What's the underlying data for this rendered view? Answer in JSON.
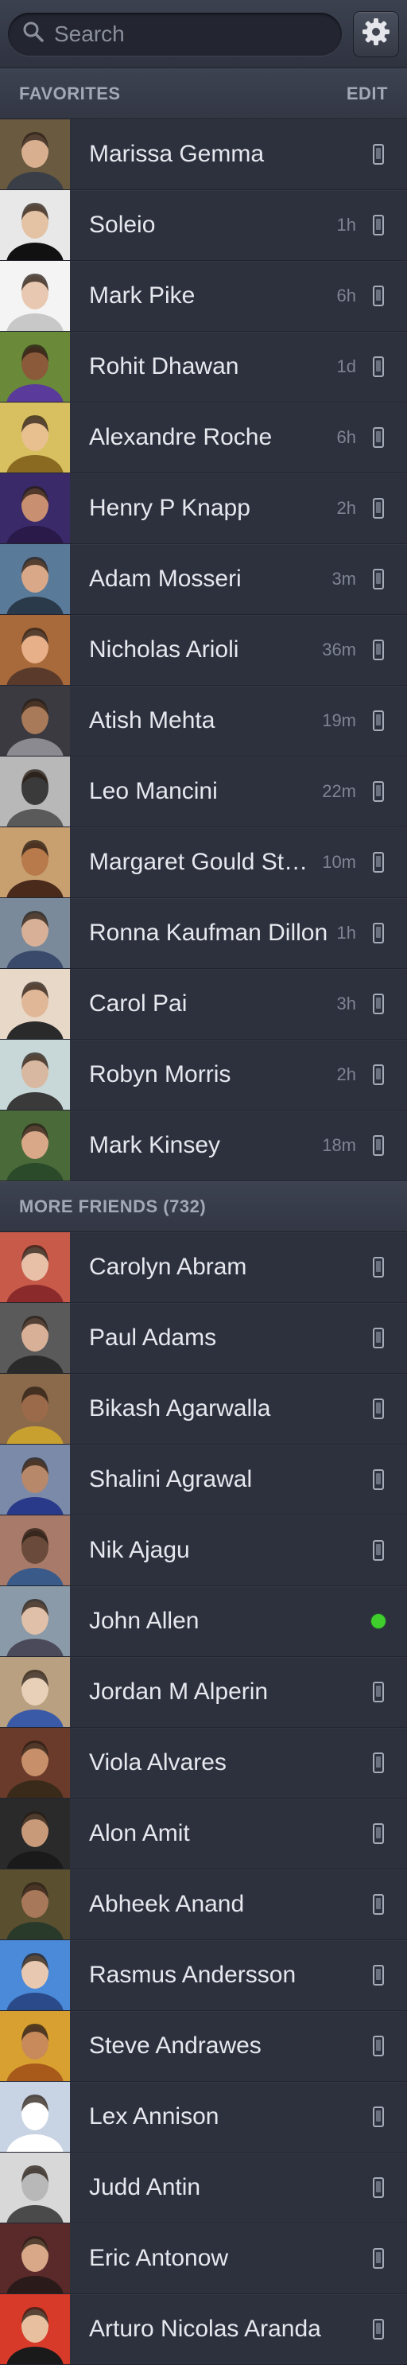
{
  "search": {
    "placeholder": "Search",
    "icon": "search-icon"
  },
  "settings": {
    "icon": "gear-icon"
  },
  "favorites": {
    "title": "FAVORITES",
    "edit_label": "EDIT",
    "items": [
      {
        "name": "Marissa Gemma",
        "time": "",
        "status": "mobile",
        "avatar_bg": "#6a5a40",
        "skin": "#d8b090",
        "shirt": "#3a3f47"
      },
      {
        "name": "Soleio",
        "time": "1h",
        "status": "mobile",
        "avatar_bg": "#e8e8e8",
        "skin": "#e4c2a4",
        "shirt": "#111111"
      },
      {
        "name": "Mark Pike",
        "time": "6h",
        "status": "mobile",
        "avatar_bg": "#f4f4f4",
        "skin": "#e8c8b0",
        "shirt": "#c8c8c8"
      },
      {
        "name": "Rohit Dhawan",
        "time": "1d",
        "status": "mobile",
        "avatar_bg": "#6a8a3a",
        "skin": "#8a5a3a",
        "shirt": "#5a3a9a"
      },
      {
        "name": "Alexandre Roche",
        "time": "6h",
        "status": "mobile",
        "avatar_bg": "#d8c060",
        "skin": "#e8c090",
        "shirt": "#8a6a20"
      },
      {
        "name": "Henry P Knapp",
        "time": "2h",
        "status": "mobile",
        "avatar_bg": "#3a2a6a",
        "skin": "#c89070",
        "shirt": "#2a1a4a"
      },
      {
        "name": "Adam Mosseri",
        "time": "3m",
        "status": "mobile",
        "avatar_bg": "#5a7a9a",
        "skin": "#d8a888",
        "shirt": "#2a3a4a"
      },
      {
        "name": "Nicholas Arioli",
        "time": "36m",
        "status": "mobile",
        "avatar_bg": "#a86a3a",
        "skin": "#e8b088",
        "shirt": "#5a3a2a"
      },
      {
        "name": "Atish Mehta",
        "time": "19m",
        "status": "mobile",
        "avatar_bg": "#3a3a40",
        "skin": "#a87a5a",
        "shirt": "#8a8a90"
      },
      {
        "name": "Leo Mancini",
        "time": "22m",
        "status": "mobile",
        "avatar_bg": "#b8b8b8",
        "skin": "#3a3a3a",
        "shirt": "#5a5a5a"
      },
      {
        "name": "Margaret Gould Stewart",
        "time": "10m",
        "status": "mobile",
        "avatar_bg": "#c8a070",
        "skin": "#b87a4a",
        "shirt": "#4a2a1a"
      },
      {
        "name": "Ronna Kaufman Dillon",
        "time": "1h",
        "status": "mobile",
        "avatar_bg": "#7a8a9a",
        "skin": "#d8b098",
        "shirt": "#3a4a6a"
      },
      {
        "name": "Carol Pai",
        "time": "3h",
        "status": "mobile",
        "avatar_bg": "#e8d8c8",
        "skin": "#e0b898",
        "shirt": "#2a2a2a"
      },
      {
        "name": "Robyn Morris",
        "time": "2h",
        "status": "mobile",
        "avatar_bg": "#c8d8d8",
        "skin": "#d8b8a0",
        "shirt": "#3a3a3a"
      },
      {
        "name": "Mark Kinsey",
        "time": "18m",
        "status": "mobile",
        "avatar_bg": "#4a6a3a",
        "skin": "#d8a888",
        "shirt": "#2a4a2a"
      }
    ]
  },
  "more_friends": {
    "title": "MORE FRIENDS (732)",
    "items": [
      {
        "name": "Carolyn Abram",
        "time": "",
        "status": "mobile",
        "avatar_bg": "#c85a4a",
        "skin": "#e8c0a8",
        "shirt": "#8a2a2a"
      },
      {
        "name": "Paul Adams",
        "time": "",
        "status": "mobile",
        "avatar_bg": "#5a5a5a",
        "skin": "#d8b098",
        "shirt": "#2a2a2a"
      },
      {
        "name": "Bikash Agarwalla",
        "time": "",
        "status": "mobile",
        "avatar_bg": "#8a6a4a",
        "skin": "#9a6a4a",
        "shirt": "#c8a030"
      },
      {
        "name": "Shalini Agrawal",
        "time": "",
        "status": "mobile",
        "avatar_bg": "#7a8aa8",
        "skin": "#b8886a",
        "shirt": "#2a3a8a"
      },
      {
        "name": "Nik Ajagu",
        "time": "",
        "status": "mobile",
        "avatar_bg": "#a87a6a",
        "skin": "#6a4a3a",
        "shirt": "#3a5a8a"
      },
      {
        "name": "John Allen",
        "time": "",
        "status": "online",
        "avatar_bg": "#8a9aa8",
        "skin": "#e0c0a8",
        "shirt": "#4a4a5a"
      },
      {
        "name": "Jordan M Alperin",
        "time": "",
        "status": "mobile",
        "avatar_bg": "#b8a080",
        "skin": "#e8d0b8",
        "shirt": "#3a5aa8"
      },
      {
        "name": "Viola Alvares",
        "time": "",
        "status": "mobile",
        "avatar_bg": "#6a3a2a",
        "skin": "#c8906a",
        "shirt": "#3a2a1a"
      },
      {
        "name": "Alon Amit",
        "time": "",
        "status": "mobile",
        "avatar_bg": "#2a2a2a",
        "skin": "#c89a7a",
        "shirt": "#1a1a1a"
      },
      {
        "name": "Abheek Anand",
        "time": "",
        "status": "mobile",
        "avatar_bg": "#5a5030",
        "skin": "#a8785a",
        "shirt": "#2a3a2a"
      },
      {
        "name": "Rasmus Andersson",
        "time": "",
        "status": "mobile",
        "avatar_bg": "#4a8ad8",
        "skin": "#e8c8b0",
        "shirt": "#2a4a8a"
      },
      {
        "name": "Steve Andrawes",
        "time": "",
        "status": "mobile",
        "avatar_bg": "#d8a030",
        "skin": "#c88a5a",
        "shirt": "#a85a1a"
      },
      {
        "name": "Lex Annison",
        "time": "",
        "status": "mobile",
        "avatar_bg": "#c8d4e4",
        "skin": "#ffffff",
        "shirt": "#ffffff"
      },
      {
        "name": "Judd Antin",
        "time": "",
        "status": "mobile",
        "avatar_bg": "#d8d8d8",
        "skin": "#b8b8b8",
        "shirt": "#4a4a4a"
      },
      {
        "name": "Eric Antonow",
        "time": "",
        "status": "mobile",
        "avatar_bg": "#5a2a2a",
        "skin": "#d8a888",
        "shirt": "#2a1a1a"
      },
      {
        "name": "Arturo Nicolas Aranda",
        "time": "",
        "status": "mobile",
        "avatar_bg": "#d83a2a",
        "skin": "#e8c0a0",
        "shirt": "#1a1a1a"
      }
    ]
  }
}
